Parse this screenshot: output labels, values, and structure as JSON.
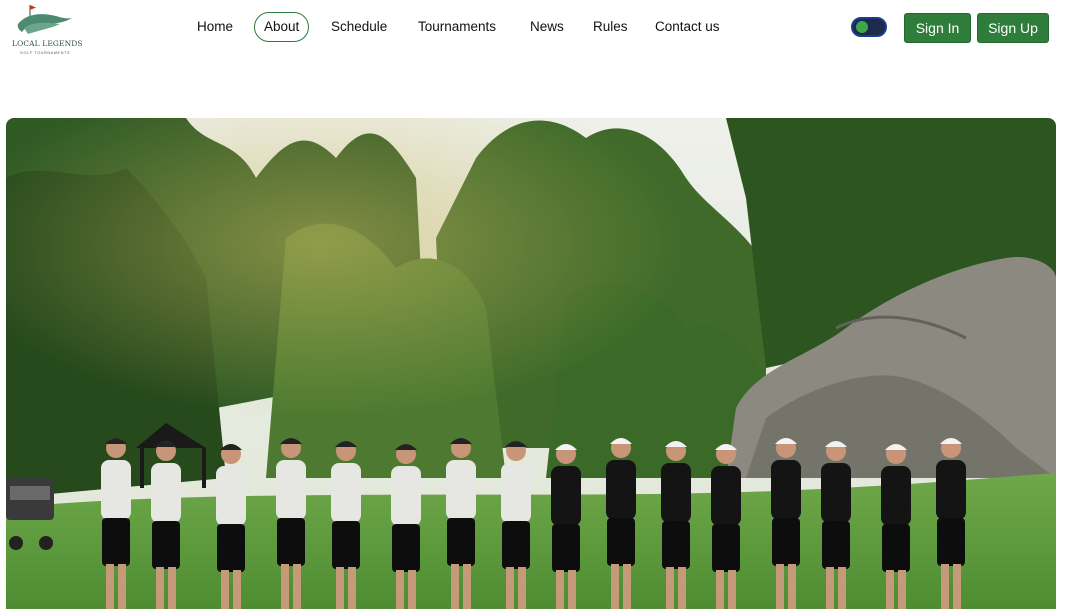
{
  "brand": {
    "name": "LOCAL LEGENDS",
    "tagline": "GOLF TOURNAMENTS",
    "logo_colors": {
      "wave": "#4d8a72",
      "flag": "#c0392b"
    }
  },
  "nav": {
    "items": [
      {
        "label": "Home",
        "active": false
      },
      {
        "label": "About",
        "active": true
      },
      {
        "label": "Schedule",
        "active": false
      },
      {
        "label": "Tournaments",
        "active": false
      },
      {
        "label": "News",
        "active": false
      },
      {
        "label": "Rules",
        "active": false
      },
      {
        "label": "Contact us",
        "active": false
      }
    ]
  },
  "theme_toggle": {
    "on": true
  },
  "auth": {
    "sign_in": "Sign In",
    "sign_up": "Sign Up"
  },
  "hero": {
    "image": "group-photo-golfers-on-course"
  },
  "colors": {
    "accent": "#2e7d3a",
    "toggle_track": "#1d2a4a",
    "text": "#111111"
  }
}
